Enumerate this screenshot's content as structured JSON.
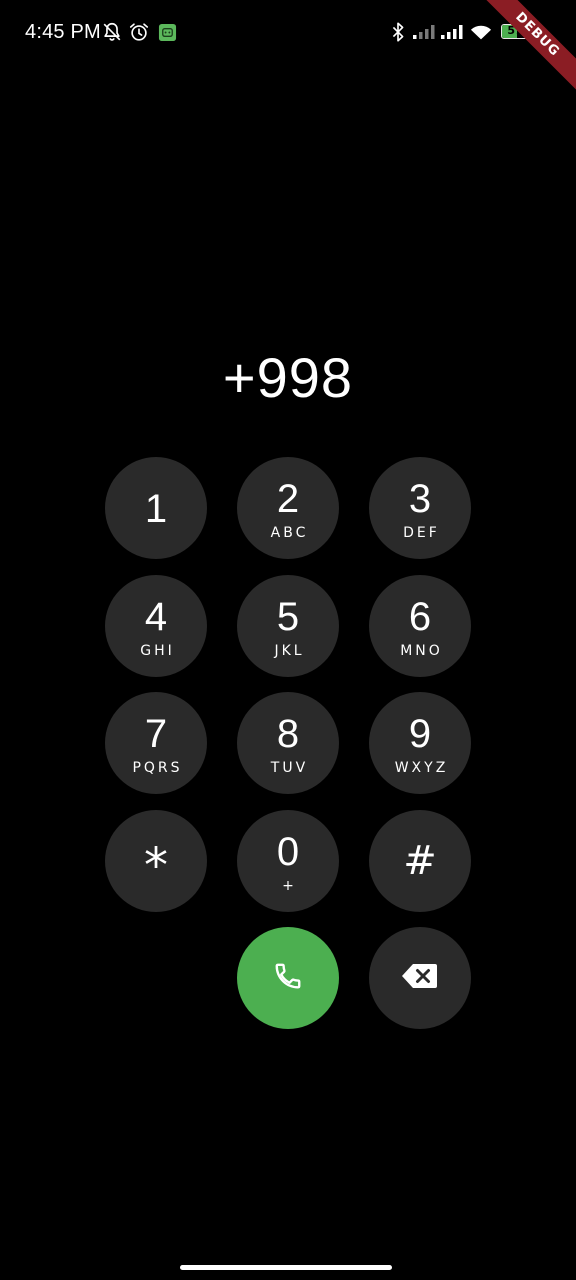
{
  "status_bar": {
    "time": "4:45 PM",
    "battery_level": "57",
    "battery_fraction": 0.57,
    "icons": [
      "bell-off-icon",
      "alarm-icon",
      "notification-app-icon",
      "bluetooth-icon",
      "signal-weak-icon",
      "signal-strong-icon",
      "wifi-icon",
      "battery-icon"
    ]
  },
  "debug_banner": "DEBUG",
  "dialer": {
    "number": "+998",
    "keys": [
      {
        "digit": "1",
        "letters": ""
      },
      {
        "digit": "2",
        "letters": "ABC"
      },
      {
        "digit": "3",
        "letters": "DEF"
      },
      {
        "digit": "4",
        "letters": "GHI"
      },
      {
        "digit": "5",
        "letters": "JKL"
      },
      {
        "digit": "6",
        "letters": "MNO"
      },
      {
        "digit": "7",
        "letters": "PQRS"
      },
      {
        "digit": "8",
        "letters": "TUV"
      },
      {
        "digit": "9",
        "letters": "WXYZ"
      },
      {
        "digit": "*",
        "letters": ""
      },
      {
        "digit": "0",
        "letters": "+"
      },
      {
        "digit": "#",
        "letters": ""
      }
    ],
    "call_icon": "phone-icon",
    "backspace_icon": "backspace-icon"
  },
  "colors": {
    "background": "#000000",
    "key_background": "#2a2a2a",
    "call_green": "#4caf50",
    "debug_red": "#8b1d24"
  }
}
